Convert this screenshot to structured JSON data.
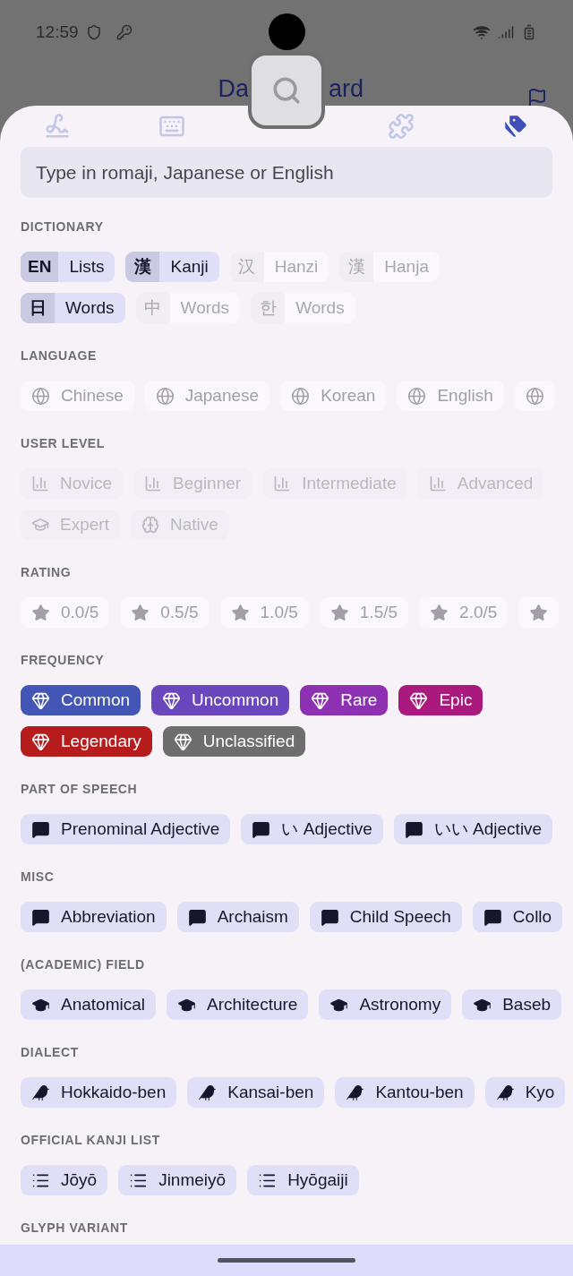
{
  "status_bar": {
    "time": "12:59"
  },
  "app_bar": {
    "title_left": "Da",
    "title_right": "ard"
  },
  "tabs": [
    {
      "kind": "handwriting",
      "selected": false
    },
    {
      "kind": "keyboard",
      "selected": false
    },
    {
      "kind": "search",
      "selected": false
    },
    {
      "kind": "radicals",
      "selected": false
    },
    {
      "kind": "tags",
      "selected": true
    }
  ],
  "search": {
    "placeholder": "Type in romaji, Japanese or English"
  },
  "sections": [
    {
      "title": "DICTIONARY",
      "kind": "dictionary",
      "chips": [
        {
          "prefix": "EN",
          "label": "Lists",
          "selected": true
        },
        {
          "prefix": "漢",
          "label": "Kanji",
          "selected": true
        },
        {
          "prefix": "汉",
          "label": "Hanzi",
          "selected": false
        },
        {
          "prefix": "漢",
          "label": "Hanja",
          "selected": false
        },
        {
          "prefix": "日",
          "label": "Words",
          "selected": true
        },
        {
          "prefix": "中",
          "label": "Words",
          "selected": false
        },
        {
          "prefix": "한",
          "label": "Words",
          "selected": false
        }
      ]
    },
    {
      "title": "LANGUAGE",
      "kind": "language",
      "chips": [
        {
          "label": "Chinese",
          "selected": false
        },
        {
          "label": "Japanese",
          "selected": false
        },
        {
          "label": "Korean",
          "selected": false
        },
        {
          "label": "English",
          "selected": false
        },
        {
          "selected": false
        }
      ]
    },
    {
      "title": "USER LEVEL",
      "kind": "level",
      "chips": [
        {
          "label": "Novice",
          "kind": "bars",
          "disabled": true
        },
        {
          "label": "Beginner",
          "kind": "bars",
          "disabled": true
        },
        {
          "label": "Intermediate",
          "kind": "bars",
          "disabled": true
        },
        {
          "label": "Advanced",
          "kind": "bars",
          "disabled": true
        },
        {
          "label": "Expert",
          "kind": "cap",
          "disabled": true
        },
        {
          "label": "Native",
          "kind": "head",
          "disabled": true
        }
      ]
    },
    {
      "title": "RATING",
      "kind": "rating",
      "chips": [
        {
          "label": "0.0/5",
          "selected": false
        },
        {
          "label": "0.5/5",
          "selected": false
        },
        {
          "label": "1.0/5",
          "selected": false
        },
        {
          "label": "1.5/5",
          "selected": false
        },
        {
          "label": "2.0/5",
          "selected": false
        },
        {
          "selected": false
        }
      ]
    },
    {
      "title": "FREQUENCY",
      "kind": "frequency",
      "chips": [
        {
          "label": "Common",
          "selected": true,
          "color": "#4355b5"
        },
        {
          "label": "Uncommon",
          "selected": true,
          "color": "#6b47be"
        },
        {
          "label": "Rare",
          "selected": true,
          "color": "#8d31b2"
        },
        {
          "label": "Epic",
          "selected": true,
          "color": "#aa1a7e"
        },
        {
          "label": "Legendary",
          "selected": true,
          "color": "#b71c1c"
        },
        {
          "label": "Unclassified",
          "selected": true,
          "color": "#6e6e6e"
        }
      ]
    },
    {
      "title": "PART OF SPEECH",
      "kind": "pos",
      "chips": [
        {
          "label": "Prenominal Adjective",
          "selected": true
        },
        {
          "label": "い Adjective",
          "selected": true
        },
        {
          "label": "いい Adjective",
          "selected": true
        }
      ]
    },
    {
      "title": "MISC",
      "kind": "misc",
      "chips": [
        {
          "label": "Abbreviation",
          "selected": true
        },
        {
          "label": "Archaism",
          "selected": true
        },
        {
          "label": "Child Speech",
          "selected": true
        },
        {
          "label": "Collo",
          "selected": true
        }
      ]
    },
    {
      "title": "(ACADEMIC) FIELD",
      "kind": "field",
      "chips": [
        {
          "label": "Anatomical",
          "selected": true
        },
        {
          "label": "Architecture",
          "selected": true
        },
        {
          "label": "Astronomy",
          "selected": true
        },
        {
          "label": "Baseb",
          "selected": true
        }
      ]
    },
    {
      "title": "DIALECT",
      "kind": "dialect",
      "chips": [
        {
          "label": "Hokkaido-ben",
          "selected": true
        },
        {
          "label": "Kansai-ben",
          "selected": true
        },
        {
          "label": "Kantou-ben",
          "selected": true
        },
        {
          "label": "Kyo",
          "selected": true
        }
      ]
    },
    {
      "title": "OFFICIAL KANJI LIST",
      "kind": "kanji_list",
      "chips": [
        {
          "label": "Jōyō",
          "selected": true
        },
        {
          "label": "Jinmeiyō",
          "selected": true
        },
        {
          "label": "Hyōgaiji",
          "selected": true
        }
      ]
    },
    {
      "title": "GLYPH VARIANT"
    }
  ]
}
